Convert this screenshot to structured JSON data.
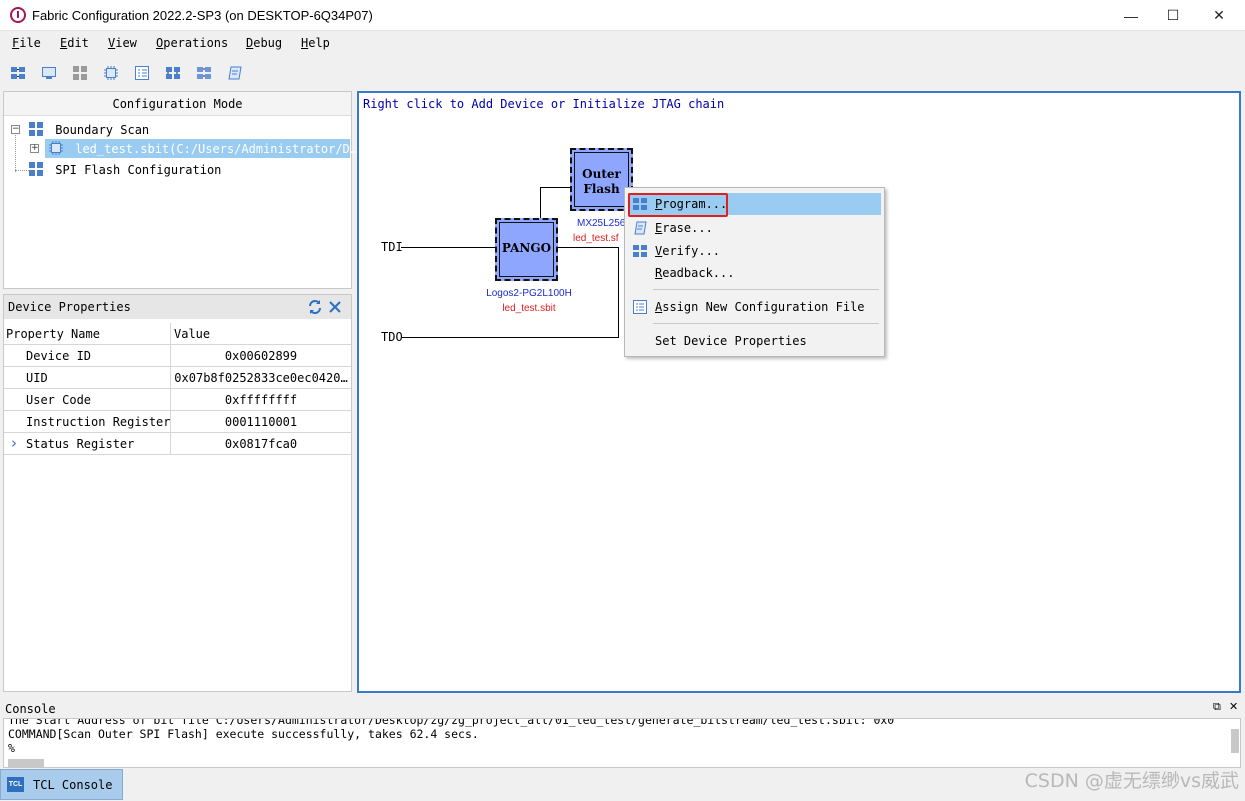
{
  "window": {
    "title": "Fabric Configuration 2022.2-SP3 (on DESKTOP-6Q34P07)",
    "minimize": "—",
    "maximize": "☐",
    "close": "✕"
  },
  "menu": [
    "File",
    "Edit",
    "View",
    "Operations",
    "Debug",
    "Help"
  ],
  "toolbar_icons": [
    "jtag-chain-icon",
    "monitor-icon",
    "grid-gray-icon",
    "chip-icon",
    "list-icon",
    "program-icon",
    "program-alt-icon",
    "erase-icon"
  ],
  "config_mode": {
    "header": "Configuration Mode",
    "boundary_scan": "Boundary Scan",
    "sbit_file": "led_test.sbit(C:/Users/Administrator/D…",
    "spi_flash": "SPI Flash Configuration",
    "expand_minus": "−",
    "expand_plus": "+"
  },
  "device_properties": {
    "title": "Device Properties",
    "columns": [
      "Property Name",
      "Value"
    ],
    "rows": [
      {
        "name": "Device ID",
        "value": "0x00602899"
      },
      {
        "name": "UID",
        "value": "0x07b8f0252833ce0ec0420…"
      },
      {
        "name": "User Code",
        "value": "0xffffffff"
      },
      {
        "name": "Instruction Register",
        "value": "0001110001"
      },
      {
        "name": "Status Register",
        "value": "0x0817fca0"
      }
    ],
    "expand_arrow": "›"
  },
  "canvas": {
    "hint": "Right click to Add Device or Initialize JTAG chain",
    "tdi": "TDI",
    "tdo": "TDO",
    "pango": {
      "label": "PANGO",
      "part": "Logos2-PG2L100H",
      "file": "led_test.sbit"
    },
    "flash": {
      "label_line1": "Outer",
      "label_line2": "Flash",
      "part": "MX25L256",
      "file": "led_test.sf"
    }
  },
  "context_menu": {
    "program": "Program...",
    "erase": "Erase...",
    "verify": "Verify...",
    "readback": "Readback...",
    "assign": "Assign New Configuration File",
    "set_props": "Set Device Properties",
    "highlight_color": "#99ccf0",
    "annotation_color": "#e02020"
  },
  "console": {
    "title": "Console",
    "lines": [
      "The Start Address of bit file C:/Users/Administrator/Desktop/zg/zg_project_all/01_led_test/generate_bitstream/led_test.sbit: 0x0",
      "COMMAND[Scan Outer SPI Flash] execute successfully, takes 62.4 secs.",
      "%"
    ],
    "tab": "TCL Console",
    "tab_icon_text": "TCL",
    "restore": "⧉",
    "close": "✕"
  },
  "watermark": "CSDN @虚无缥缈vs威武"
}
